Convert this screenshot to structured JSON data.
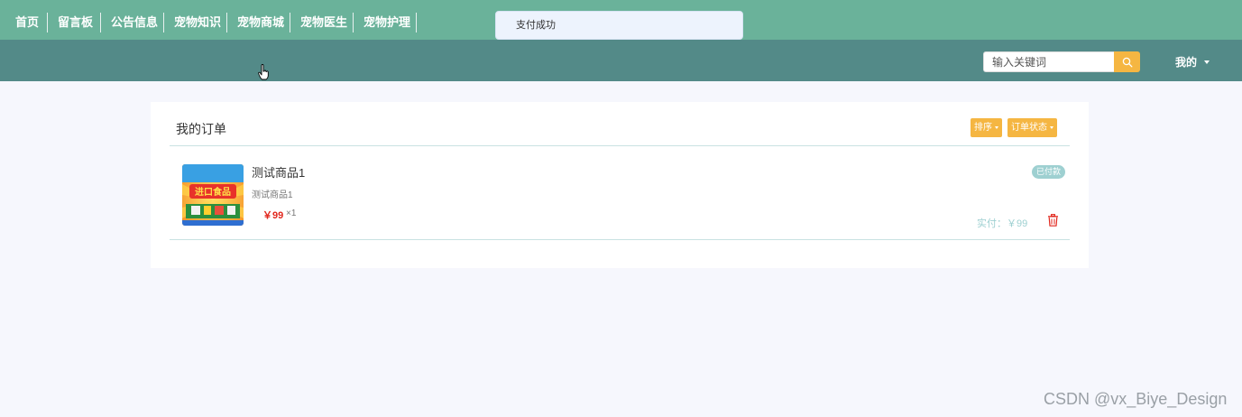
{
  "toast": {
    "message": "支付成功"
  },
  "nav": {
    "items": [
      "首页",
      "留言板",
      "公告信息",
      "宠物知识",
      "宠物商城",
      "宠物医生",
      "宠物护理"
    ],
    "search_placeholder": "输入关键词",
    "me_label": "我的"
  },
  "orders": {
    "title": "我的订单",
    "sort_label": "排序",
    "status_filter_label": "订单状态",
    "items": [
      {
        "name": "测试商品1",
        "description": "测试商品1",
        "price": "￥99",
        "quantity": "×1",
        "status": "已付款",
        "paid_label": "实付：￥99",
        "thumb_text": "进口食品"
      }
    ]
  },
  "watermark": "CSDN @vx_Biye_Design",
  "colors": {
    "header": "#6ab29a",
    "navbar": "#538a88",
    "accent": "#f5b642",
    "price": "#e1261c",
    "badge": "#9ed0d1"
  }
}
